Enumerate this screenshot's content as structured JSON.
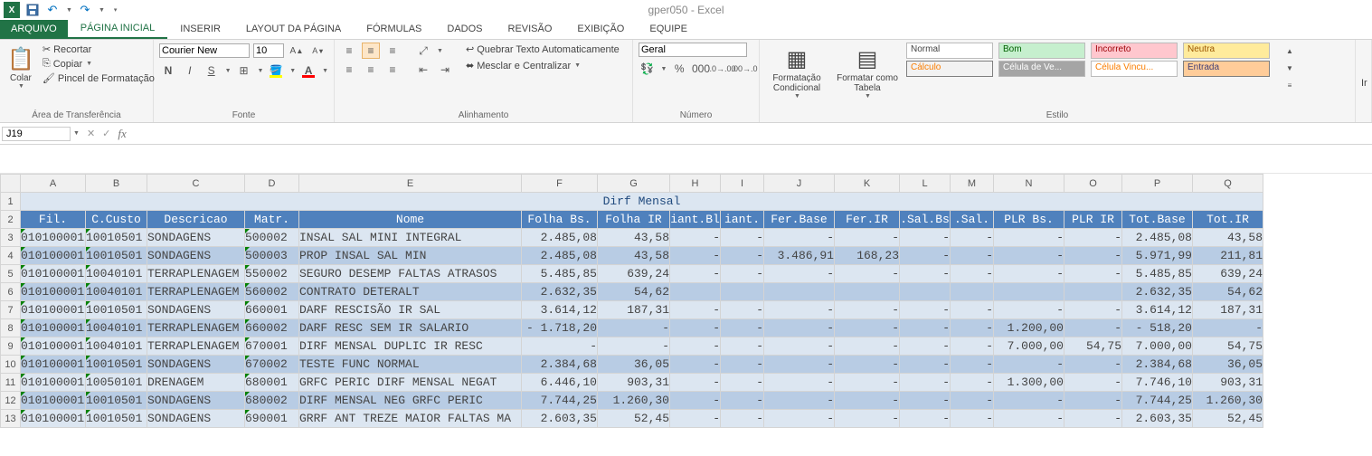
{
  "window": {
    "title": "gper050 - Excel"
  },
  "qat": {
    "undo": "↶",
    "redo": "↷"
  },
  "tabs": {
    "file": "ARQUIVO",
    "items": [
      "PÁGINA INICIAL",
      "INSERIR",
      "LAYOUT DA PÁGINA",
      "FÓRMULAS",
      "DADOS",
      "REVISÃO",
      "EXIBIÇÃO",
      "EQUIPE"
    ],
    "active": 0
  },
  "ribbon": {
    "clipboard": {
      "paste": "Colar",
      "cut": "Recortar",
      "copy": "Copiar",
      "painter": "Pincel de Formatação",
      "label": "Área de Transferência"
    },
    "font": {
      "name": "Courier New",
      "size": "10",
      "bold": "N",
      "italic": "I",
      "underline": "S",
      "label": "Fonte"
    },
    "align": {
      "wrap": "Quebrar Texto Automaticamente",
      "merge": "Mesclar e Centralizar",
      "label": "Alinhamento"
    },
    "number": {
      "format": "Geral",
      "label": "Número"
    },
    "styles": {
      "cond": "Formatação Condicional",
      "table": "Formatar como Tabela",
      "label": "Estilo",
      "cells": [
        "Normal",
        "Bom",
        "Incorreto",
        "Neutra",
        "Cálculo",
        "Célula de Ve...",
        "Célula Vincu...",
        "Entrada"
      ]
    }
  },
  "formula_bar": {
    "name_box": "J19",
    "cancel": "✕",
    "enter": "✓",
    "fx": "fx",
    "value": ""
  },
  "sheet": {
    "cols": [
      "A",
      "B",
      "C",
      "D",
      "E",
      "F",
      "G",
      "H",
      "I",
      "J",
      "K",
      "L",
      "M",
      "N",
      "O",
      "P",
      "Q"
    ],
    "report_title": "Dirf Mensal",
    "headers": [
      "Fil.",
      "C.Custo",
      "Descricao",
      "Matr.",
      "Nome",
      "Folha Bs.",
      "Folha IR",
      "iant.Bl",
      "iant.",
      "Fer.Base",
      "Fer.IR",
      ".Sal.Bs",
      ".Sal.",
      "PLR Bs.",
      "PLR IR",
      "Tot.Base",
      "Tot.IR"
    ],
    "rows": [
      {
        "A": "010100001",
        "B": "10010501",
        "C": "SONDAGENS",
        "D": "500002",
        "E": "INSAL SAL MINI INTEGRAL",
        "F": "2.485,08",
        "G": "43,58",
        "H": "-",
        "I": "-",
        "J": "-",
        "K": "-",
        "L": "-",
        "M": "-",
        "N": "-",
        "O": "-",
        "P": "2.485,08",
        "Q": "43,58"
      },
      {
        "A": "010100001",
        "B": "10010501",
        "C": "SONDAGENS",
        "D": "500003",
        "E": "PROP INSAL SAL MIN",
        "F": "2.485,08",
        "G": "43,58",
        "H": "-",
        "I": "-",
        "J": "3.486,91",
        "K": "168,23",
        "L": "-",
        "M": "-",
        "N": "-",
        "O": "-",
        "P": "5.971,99",
        "Q": "211,81"
      },
      {
        "A": "010100001",
        "B": "10040101",
        "C": "TERRAPLENAGEM",
        "D": "550002",
        "E": "SEGURO DESEMP FALTAS ATRASOS",
        "F": "5.485,85",
        "G": "639,24",
        "H": "-",
        "I": "-",
        "J": "-",
        "K": "-",
        "L": "-",
        "M": "-",
        "N": "-",
        "O": "-",
        "P": "5.485,85",
        "Q": "639,24"
      },
      {
        "A": "010100001",
        "B": "10040101",
        "C": "TERRAPLENAGEM",
        "D": "560002",
        "E": "CONTRATO DETERALT",
        "F": "2.632,35",
        "G": "54,62",
        "H": "",
        "I": "",
        "J": "",
        "K": "",
        "L": "",
        "M": "",
        "N": "",
        "O": "",
        "P": "2.632,35",
        "Q": "54,62"
      },
      {
        "A": "010100001",
        "B": "10010501",
        "C": "SONDAGENS",
        "D": "660001",
        "E": "DARF RESCISÃO IR SAL",
        "F": "3.614,12",
        "G": "187,31",
        "H": "-",
        "I": "-",
        "J": "-",
        "K": "-",
        "L": "-",
        "M": "-",
        "N": "-",
        "O": "-",
        "P": "3.614,12",
        "Q": "187,31"
      },
      {
        "A": "010100001",
        "B": "10040101",
        "C": "TERRAPLENAGEM",
        "D": "660002",
        "E": "DARF RESC SEM IR SALARIO",
        "F": "-  1.718,20",
        "G": "-",
        "H": "-",
        "I": "-",
        "J": "-",
        "K": "-",
        "L": "-",
        "M": "-",
        "N": "1.200,00",
        "O": "-",
        "P": "-    518,20",
        "Q": "-"
      },
      {
        "A": "010100001",
        "B": "10040101",
        "C": "TERRAPLENAGEM",
        "D": "670001",
        "E": "DIRF MENSAL DUPLIC IR RESC",
        "F": "-",
        "G": "-",
        "H": "-",
        "I": "-",
        "J": "-",
        "K": "-",
        "L": "-",
        "M": "-",
        "N": "7.000,00",
        "O": "54,75",
        "P": "7.000,00",
        "Q": "54,75"
      },
      {
        "A": "010100001",
        "B": "10010501",
        "C": "SONDAGENS",
        "D": "670002",
        "E": "TESTE FUNC NORMAL",
        "F": "2.384,68",
        "G": "36,05",
        "H": "-",
        "I": "-",
        "J": "-",
        "K": "-",
        "L": "-",
        "M": "-",
        "N": "-",
        "O": "-",
        "P": "2.384,68",
        "Q": "36,05"
      },
      {
        "A": "010100001",
        "B": "10050101",
        "C": "DRENAGEM",
        "D": "680001",
        "E": "GRFC PERIC DIRF MENSAL NEGAT",
        "F": "6.446,10",
        "G": "903,31",
        "H": "-",
        "I": "-",
        "J": "-",
        "K": "-",
        "L": "-",
        "M": "-",
        "N": "1.300,00",
        "O": "-",
        "P": "7.746,10",
        "Q": "903,31"
      },
      {
        "A": "010100001",
        "B": "10010501",
        "C": "SONDAGENS",
        "D": "680002",
        "E": "DIRF MENSAL NEG GRFC PERIC",
        "F": "7.744,25",
        "G": "1.260,30",
        "H": "-",
        "I": "-",
        "J": "-",
        "K": "-",
        "L": "-",
        "M": "-",
        "N": "-",
        "O": "-",
        "P": "7.744,25",
        "Q": "1.260,30"
      },
      {
        "A": "010100001",
        "B": "10010501",
        "C": "SONDAGENS",
        "D": "690001",
        "E": "GRRF ANT TREZE MAIOR FALTAS MA",
        "F": "2.603,35",
        "G": "52,45",
        "H": "-",
        "I": "-",
        "J": "-",
        "K": "-",
        "L": "-",
        "M": "-",
        "N": "-",
        "O": "-",
        "P": "2.603,35",
        "Q": "52,45"
      }
    ]
  }
}
